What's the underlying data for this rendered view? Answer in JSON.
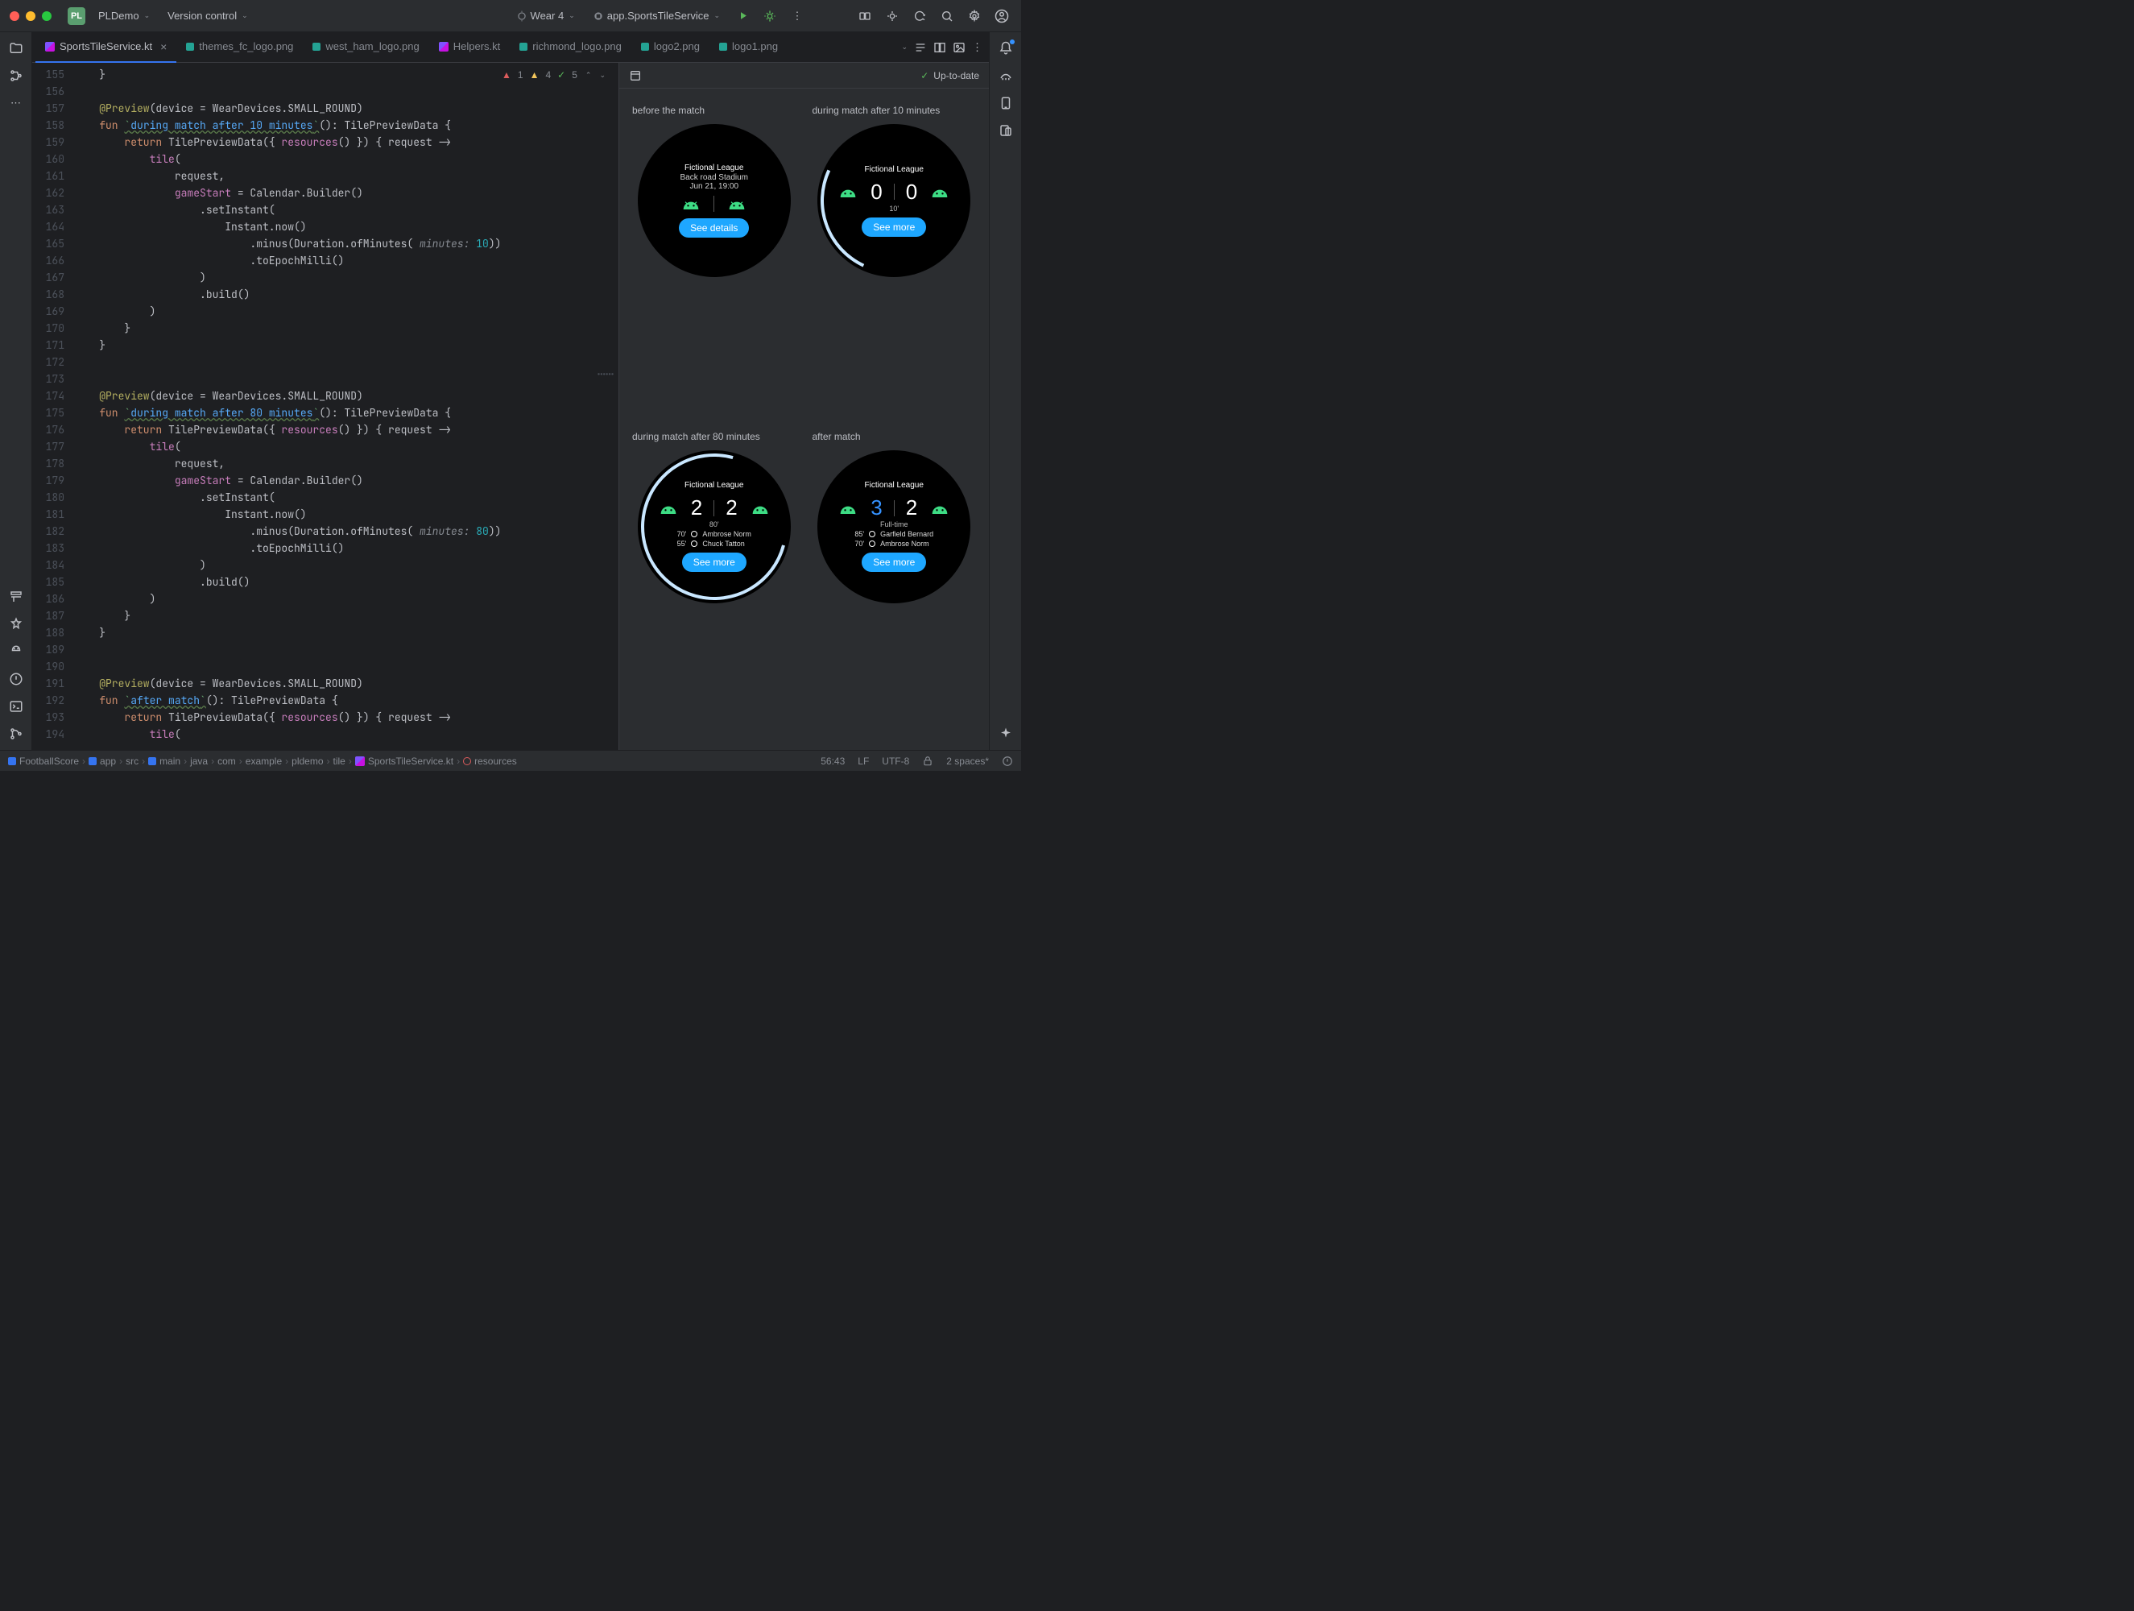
{
  "titlebar": {
    "project_badge": "PL",
    "project_name": "PLDemo",
    "vcs": "Version control",
    "device": "Wear 4",
    "run_config": "app.SportsTileService"
  },
  "tabs": [
    {
      "label": "SportsTileService.kt",
      "icon": "kt",
      "active": true,
      "close": true
    },
    {
      "label": "themes_fc_logo.png",
      "icon": "img"
    },
    {
      "label": "west_ham_logo.png",
      "icon": "img"
    },
    {
      "label": "Helpers.kt",
      "icon": "kt"
    },
    {
      "label": "richmond_logo.png",
      "icon": "img"
    },
    {
      "label": "logo2.png",
      "icon": "img"
    },
    {
      "label": "logo1.png",
      "icon": "img"
    }
  ],
  "inspections": {
    "error": "1",
    "warn": "4",
    "ok": "5"
  },
  "code": {
    "annotation": "@Preview",
    "device_arg": "(device = WearDevices.SMALL_ROUND)",
    "fun": "fun",
    "fn10": "during match after 10 minutes",
    "fn80": "during match after 80 minutes",
    "fnafter": "after match",
    "sig": "(): TilePreviewData {",
    "ret": "return",
    "tpd": " TilePreviewData({ ",
    "resources": "resources",
    "tpd2": "() }) { request ->",
    "tile": "tile",
    "tile_p": "(",
    "request": "request,",
    "gameStart": "gameStart",
    "calendar": " = Calendar.Builder()",
    "setInstant": ".setInstant(",
    "now": "Instant.now()",
    "minus1": ".minus(Duration.ofMinutes(",
    "minutes_hint": " minutes: ",
    "min10": "10",
    "min80": "80",
    "minus2": "))",
    "toEpoch": ".toEpochMilli()",
    "close_p": ")",
    "build": ".build()",
    "close_brace": "}"
  },
  "lines": [
    "155",
    "156",
    "157",
    "158",
    "159",
    "160",
    "161",
    "162",
    "163",
    "164",
    "165",
    "166",
    "167",
    "168",
    "169",
    "170",
    "171",
    "172",
    "173",
    "174",
    "175",
    "176",
    "177",
    "178",
    "179",
    "180",
    "181",
    "182",
    "183",
    "184",
    "185",
    "186",
    "187",
    "188",
    "189",
    "190",
    "191",
    "192",
    "193",
    "194"
  ],
  "preview": {
    "status": "Up-to-date",
    "cells": [
      {
        "label": "before the match",
        "league": "Fictional League",
        "sub1": "Back road Stadium",
        "sub2": "Jun 21, 19:00",
        "btn": "See details"
      },
      {
        "label": "during match after 10 minutes",
        "league": "Fictional League",
        "score1": "0",
        "score2": "0",
        "minute": "10'",
        "btn": "See more",
        "arc": "a10"
      },
      {
        "label": "during match after 80 minutes",
        "league": "Fictional League",
        "score1": "2",
        "score2": "2",
        "minute": "80'",
        "btn": "See more",
        "arc": "a80",
        "scorers": [
          {
            "t": "70'",
            "n": "Ambrose Norm"
          },
          {
            "t": "55'",
            "n": "Chuck Tatton"
          }
        ]
      },
      {
        "label": "after match",
        "league": "Fictional League",
        "score1": "3",
        "score2": "2",
        "score1win": true,
        "minute": "Full-time",
        "btn": "See more",
        "scorers": [
          {
            "t": "85'",
            "n": "Garfield Bernard"
          },
          {
            "t": "70'",
            "n": "Ambrose Norm"
          }
        ]
      }
    ]
  },
  "breadcrumb": [
    "FootballScore",
    "app",
    "src",
    "main",
    "java",
    "com",
    "example",
    "pldemo",
    "tile",
    "SportsTileService.kt",
    "resources"
  ],
  "status": {
    "pos": "56:43",
    "le": "LF",
    "enc": "UTF-8",
    "indent": "2 spaces*"
  }
}
